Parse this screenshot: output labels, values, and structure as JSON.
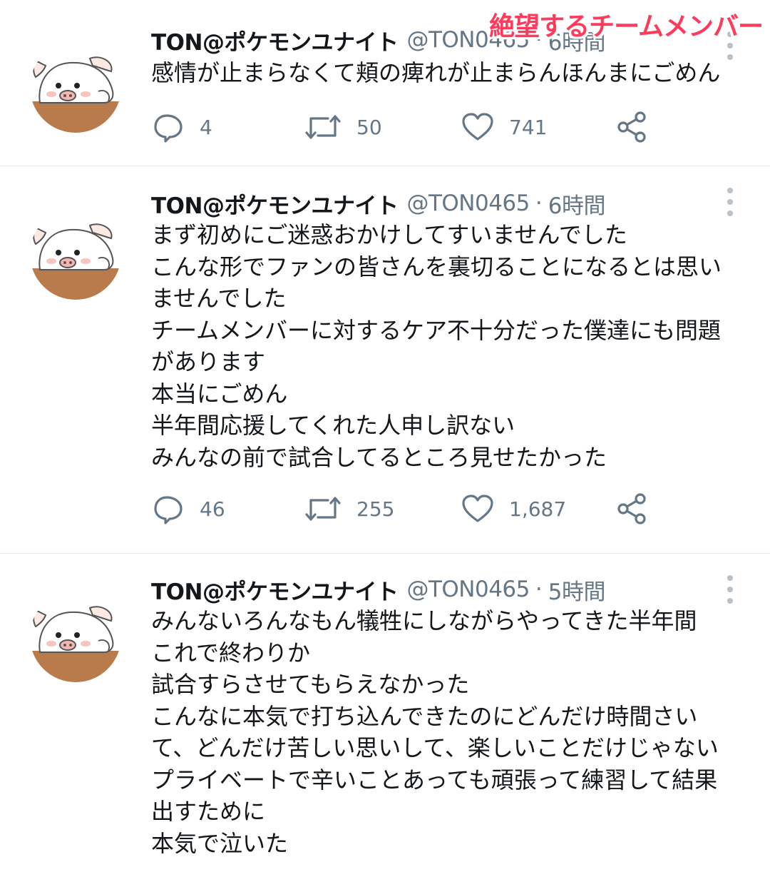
{
  "overlay": {
    "caption": "絶望するチームメンバー"
  },
  "tweets": [
    {
      "author": {
        "name": "TON@ポケモンユナイト",
        "handle": "@TON0465",
        "time": "6時間"
      },
      "separator": "·",
      "lines": [
        "感情が止まらなくて頬の痺れが止まらんほんまにごめん"
      ],
      "stats": {
        "replies": "4",
        "retweets": "50",
        "likes": "741"
      }
    },
    {
      "author": {
        "name": "TON@ポケモンユナイト",
        "handle": "@TON0465",
        "time": "6時間"
      },
      "separator": "·",
      "lines": [
        "まず初めにご迷惑おかけしてすいませんでした",
        "こんな形でファンの皆さんを裏切ることになるとは思い",
        "ませんでした",
        "チームメンバーに対するケア不十分だった僕達にも問題",
        "があります",
        "本当にごめん",
        "半年間応援してくれた人申し訳ない",
        "みんなの前で試合してるところ見せたかった"
      ],
      "stats": {
        "replies": "46",
        "retweets": "255",
        "likes": "1,687"
      }
    },
    {
      "author": {
        "name": "TON@ポケモンユナイト",
        "handle": "@TON0465",
        "time": "5時間"
      },
      "separator": "·",
      "lines": [
        "みんないろんなもん犠牲にしながらやってきた半年間",
        "これで終わりか",
        "試合すらさせてもらえなかった",
        "こんなに本気で打ち込んできたのにどんだけ時間さい",
        "て、どんだけ苦しい思いして、楽しいことだけじゃない",
        "プライベートで辛いことあっても頑張って練習して結果",
        "出すために",
        "本気で泣いた"
      ]
    }
  ],
  "icons": {
    "reply": "speech-bubble-icon",
    "retweet": "retweet-arrows-icon",
    "like": "heart-outline-icon",
    "share": "share-nodes-icon",
    "more": "vertical-dots-icon"
  },
  "colors": {
    "text": "#14171a",
    "secondary": "#657786",
    "divider": "#e1e8ed",
    "caption": "#ff3b5c"
  }
}
